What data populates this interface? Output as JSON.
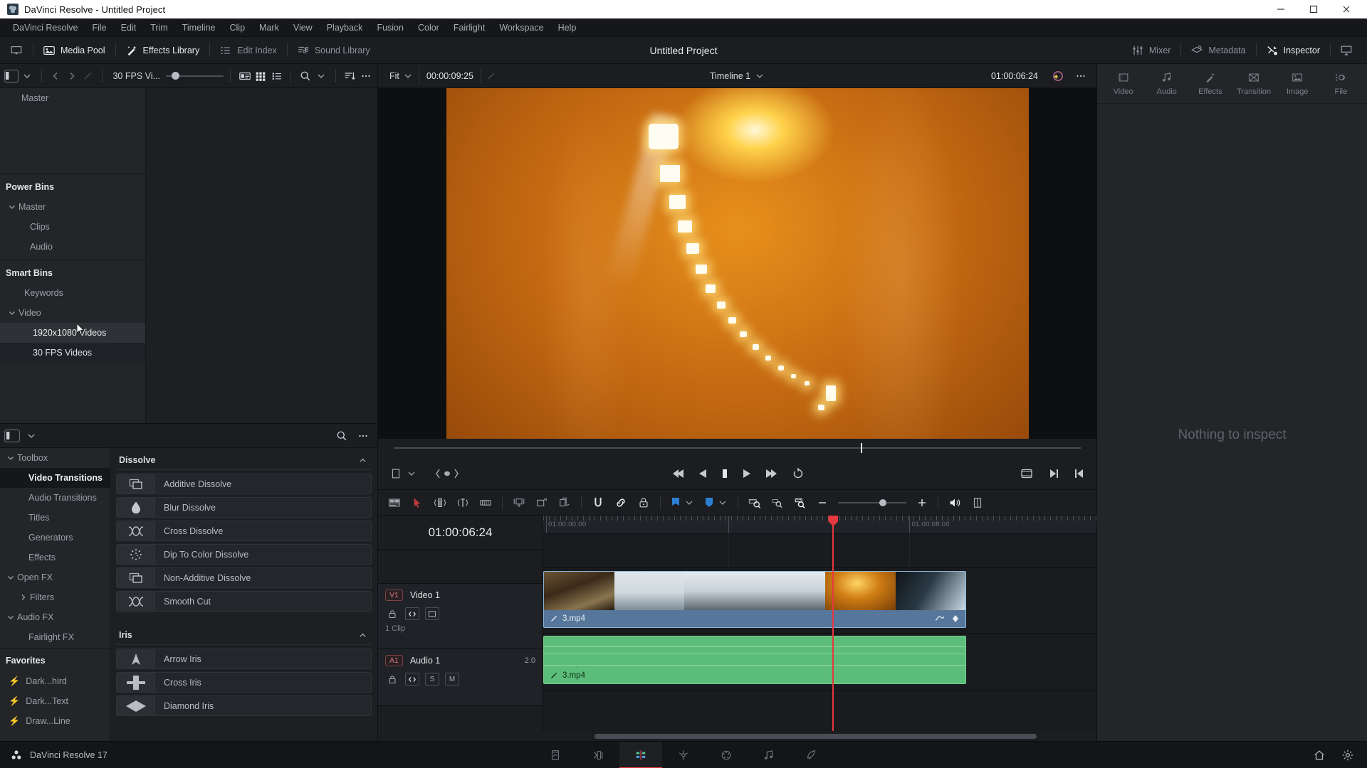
{
  "window": {
    "title": "DaVinci Resolve - Untitled Project",
    "minimize": "—",
    "maximize": "☐",
    "close": "✕"
  },
  "menubar": {
    "items": [
      "DaVinci Resolve",
      "File",
      "Edit",
      "Trim",
      "Timeline",
      "Clip",
      "Mark",
      "View",
      "Playback",
      "Fusion",
      "Color",
      "Fairlight",
      "Workspace",
      "Help"
    ]
  },
  "toolbar": {
    "project_title": "Untitled Project",
    "left_items": [
      {
        "label": "Media Pool",
        "icon": "media-pool-icon",
        "active": true
      },
      {
        "label": "Effects Library",
        "icon": "effects-library-icon",
        "active": true
      },
      {
        "label": "Edit Index",
        "icon": "edit-index-icon",
        "active": false
      },
      {
        "label": "Sound Library",
        "icon": "sound-library-icon",
        "active": false
      }
    ],
    "right_items": [
      {
        "label": "Mixer",
        "icon": "mixer-icon",
        "active": false
      },
      {
        "label": "Metadata",
        "icon": "metadata-icon",
        "active": false
      },
      {
        "label": "Inspector",
        "icon": "inspector-icon",
        "active": true
      }
    ]
  },
  "media_pool": {
    "toolbar": {
      "bin_filter": "30 FPS Vi...",
      "slider_value": 8
    },
    "tree": {
      "top": [
        {
          "label": "Master",
          "indent": 1,
          "caret": "",
          "selected": false
        }
      ],
      "power_bins_header": "Power Bins",
      "power_bins": [
        {
          "label": "Master",
          "indent": 0,
          "caret": "down",
          "selected": false
        },
        {
          "label": "Clips",
          "indent": 1,
          "caret": "",
          "selected": false
        },
        {
          "label": "Audio",
          "indent": 1,
          "caret": "",
          "selected": false
        }
      ],
      "smart_bins_header": "Smart Bins",
      "smart_bins": [
        {
          "label": "Keywords",
          "indent": 1,
          "caret": "",
          "selected": false
        },
        {
          "label": "Video",
          "indent": 0,
          "caret": "down",
          "selected": false
        },
        {
          "label": "1920x1080 Videos",
          "indent": 2,
          "caret": "",
          "selected": true
        },
        {
          "label": "30 FPS Videos",
          "indent": 2,
          "caret": "",
          "selected": false
        }
      ]
    }
  },
  "effects_library": {
    "tree": [
      {
        "label": "Toolbox",
        "indent": 0,
        "caret": "down",
        "selected": false
      },
      {
        "label": "Video Transitions",
        "indent": 1,
        "caret": "",
        "selected": true
      },
      {
        "label": "Audio Transitions",
        "indent": 1,
        "caret": "",
        "selected": false
      },
      {
        "label": "Titles",
        "indent": 1,
        "caret": "",
        "selected": false
      },
      {
        "label": "Generators",
        "indent": 1,
        "caret": "",
        "selected": false
      },
      {
        "label": "Effects",
        "indent": 1,
        "caret": "",
        "selected": false
      },
      {
        "label": "Open FX",
        "indent": 0,
        "caret": "down",
        "selected": false
      },
      {
        "label": "Filters",
        "indent": 1,
        "caret": "right",
        "selected": false
      },
      {
        "label": "Audio FX",
        "indent": 0,
        "caret": "down",
        "selected": false
      },
      {
        "label": "Fairlight FX",
        "indent": 1,
        "caret": "",
        "selected": false
      }
    ],
    "favorites_header": "Favorites",
    "favorites": [
      {
        "label": "Dark...hird",
        "icon": "bolt-icon"
      },
      {
        "label": "Dark...Text",
        "icon": "bolt-icon"
      },
      {
        "label": "Draw...Line",
        "icon": "bolt-icon"
      }
    ],
    "search_placeholder": "",
    "groups": [
      {
        "title": "Dissolve",
        "items": [
          {
            "label": "Additive Dissolve",
            "icon": "additive-dissolve-icon"
          },
          {
            "label": "Blur Dissolve",
            "icon": "blur-dissolve-icon"
          },
          {
            "label": "Cross Dissolve",
            "icon": "cross-dissolve-icon"
          },
          {
            "label": "Dip To Color Dissolve",
            "icon": "dip-to-color-dissolve-icon"
          },
          {
            "label": "Non-Additive Dissolve",
            "icon": "non-additive-dissolve-icon"
          },
          {
            "label": "Smooth Cut",
            "icon": "smooth-cut-icon"
          }
        ]
      },
      {
        "title": "Iris",
        "items": [
          {
            "label": "Arrow Iris",
            "icon": "arrow-iris-icon"
          },
          {
            "label": "Cross Iris",
            "icon": "cross-iris-icon"
          },
          {
            "label": "Diamond Iris",
            "icon": "diamond-iris-icon"
          }
        ]
      }
    ]
  },
  "viewer": {
    "zoom_level": "Fit",
    "timecode": "00:00:09:25",
    "timeline_name": "Timeline 1",
    "scrub_position_pct": 68
  },
  "timeline": {
    "timecode": "01:00:06:24",
    "ruler_labels": [
      {
        "text": "01:00:00:00",
        "left_pct": 0.5
      },
      {
        "text": "01:00:08:00",
        "left_pct": 66.2
      }
    ],
    "playhead_pct": 52.3,
    "zoom_value": 60,
    "tracks": [
      {
        "id": "V1",
        "name": "Video 1",
        "type": "video",
        "clip_count": "1 Clip",
        "gain": "",
        "buttons": [
          "lock-icon",
          "auto-select-icon",
          "video-enable-icon"
        ],
        "clip": {
          "name": "3.mp4",
          "left_pct": 0,
          "width_pct": 76.5
        }
      },
      {
        "id": "A1",
        "name": "Audio 1",
        "type": "audio",
        "clip_count": "",
        "gain": "2.0",
        "buttons": [
          "lock-icon",
          "auto-select-icon",
          "solo-icon",
          "mute-icon"
        ],
        "clip": {
          "name": "3.mp4",
          "left_pct": 0,
          "width_pct": 76.5
        }
      }
    ]
  },
  "inspector": {
    "tabs": [
      {
        "label": "Video",
        "icon": "video-icon"
      },
      {
        "label": "Audio",
        "icon": "audio-icon"
      },
      {
        "label": "Effects",
        "icon": "effects-icon"
      },
      {
        "label": "Transition",
        "icon": "transition-icon"
      },
      {
        "label": "Image",
        "icon": "image-icon"
      },
      {
        "label": "File",
        "icon": "file-icon"
      }
    ],
    "empty_message": "Nothing to inspect"
  },
  "statusbar": {
    "app_name": "DaVinci Resolve 17",
    "pages": [
      {
        "name": "media",
        "icon": "media-page-icon",
        "active": false
      },
      {
        "name": "cut",
        "icon": "cut-page-icon",
        "active": false
      },
      {
        "name": "edit",
        "icon": "edit-page-icon",
        "active": true
      },
      {
        "name": "fusion",
        "icon": "fusion-page-icon",
        "active": false
      },
      {
        "name": "color",
        "icon": "color-page-icon",
        "active": false
      },
      {
        "name": "fairlight",
        "icon": "fairlight-page-icon",
        "active": false
      },
      {
        "name": "deliver",
        "icon": "deliver-page-icon",
        "active": false
      }
    ],
    "right_icons": [
      "home-icon",
      "settings-icon"
    ]
  },
  "colors": {
    "accent_red": "#e5393f",
    "video_clip": "#56779b",
    "audio_clip": "#5bbd79",
    "panel_bg": "#1b1d21"
  }
}
